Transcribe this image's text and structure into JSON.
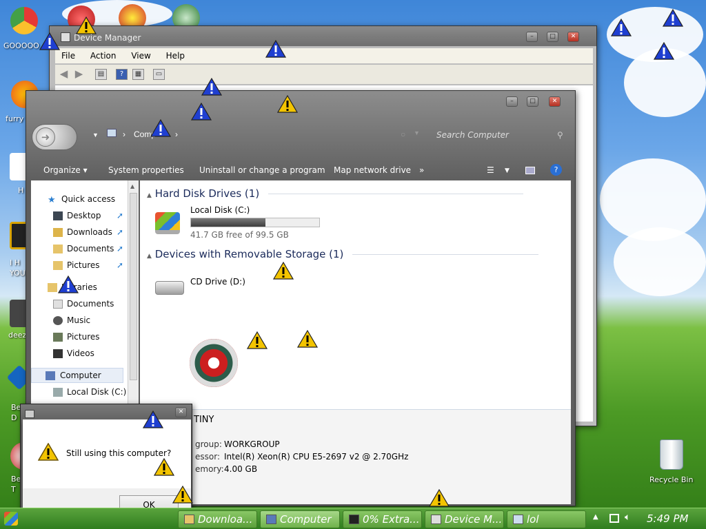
{
  "desktop": {
    "icons": [
      {
        "label": "GOOOOO"
      },
      {
        "label": "furry"
      },
      {
        "label": "H"
      },
      {
        "label": "I H YOU"
      },
      {
        "label": "deez"
      },
      {
        "label": "Be D"
      },
      {
        "label": "Be T"
      },
      {
        "label": "Recycle Bin"
      }
    ]
  },
  "device_manager": {
    "title": "Device Manager",
    "menu": [
      "File",
      "Action",
      "View",
      "Help"
    ]
  },
  "explorer": {
    "breadcrumb": [
      "Comp"
    ],
    "search_placeholder": "Search Computer",
    "commands": [
      "Organize ▾",
      "System properties",
      "Uninstall or change a program",
      "Map network drive",
      "»"
    ],
    "nav": {
      "quick_access": "Quick access",
      "quick_items": [
        "Desktop",
        "Downloads",
        "Documents",
        "Pictures"
      ],
      "libraries": "Libraries",
      "library_items": [
        "Documents",
        "Music",
        "Pictures",
        "Videos"
      ],
      "computer": "Computer",
      "computer_items": [
        "Local Disk (C:)"
      ]
    },
    "groups": {
      "hdd": "Hard Disk Drives (1)",
      "removable": "Devices with Removable Storage (1)"
    },
    "drives": {
      "c_name": "Local Disk (C:)",
      "c_free": "41.7 GB free of 99.5 GB",
      "c_used_fraction": 0.58,
      "d_name": "CD Drive (D:)"
    },
    "details": {
      "name": "TINY",
      "rows": [
        {
          "label": "group:",
          "value": "WORKGROUP"
        },
        {
          "label": "essor:",
          "value": "Intel(R) Xeon(R) CPU E5-2697 v2 @ 2.70GHz"
        },
        {
          "label": "emory:",
          "value": "4.00 GB"
        }
      ]
    }
  },
  "dialog": {
    "message": "Still using this computer?",
    "ok_label": "OK"
  },
  "taskbar": {
    "buttons": [
      "Downloa...",
      "Computer",
      "0% Extra...",
      "Device M...",
      "lol"
    ],
    "clock": "5:49 PM"
  },
  "colors": {
    "taskbar": "#3f8f2a",
    "warning_yellow": "#f3c400",
    "warning_blue": "#1f3fd1"
  }
}
